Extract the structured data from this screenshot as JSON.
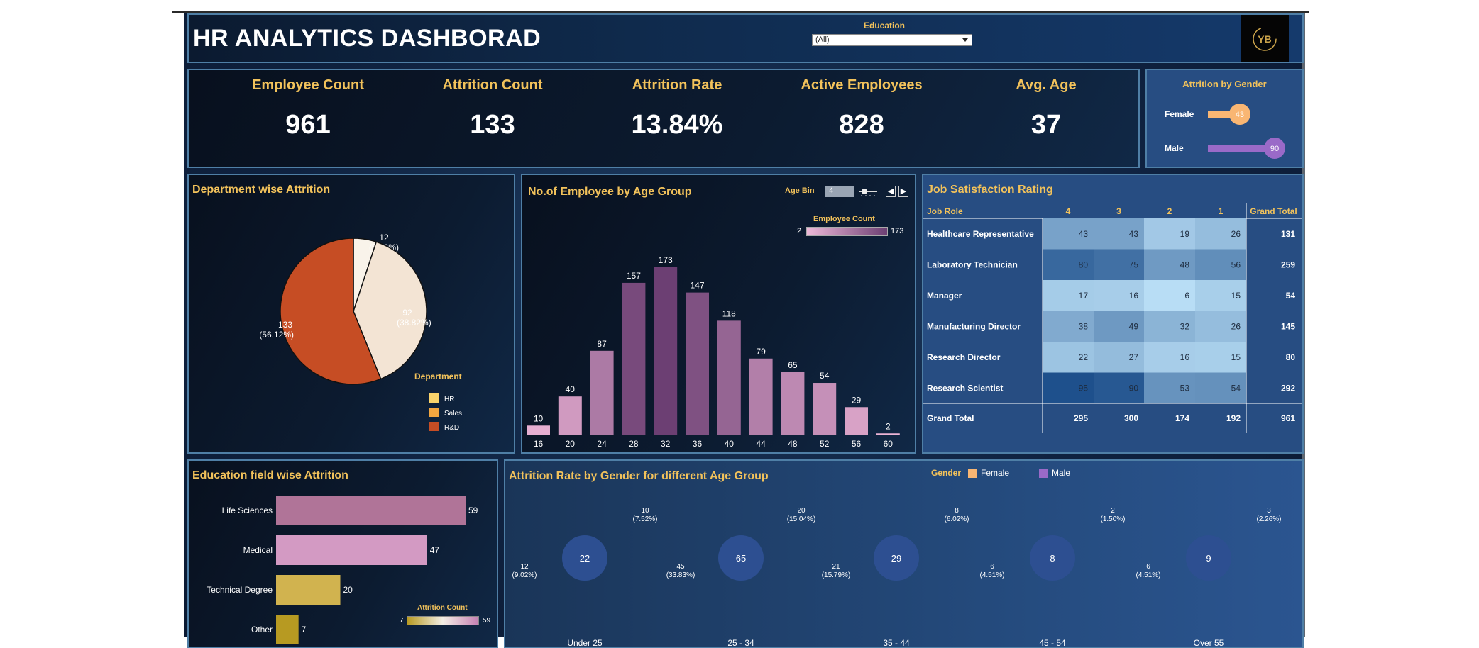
{
  "header": {
    "title": "HR ANALYTICS DASHBORAD",
    "filter_label": "Education",
    "filter_value": "(All)"
  },
  "kpis": [
    {
      "label": "Employee Count",
      "value": "961"
    },
    {
      "label": "Attrition Count",
      "value": "133"
    },
    {
      "label": "Attrition Rate",
      "value": "13.84%"
    },
    {
      "label": "Active Employees",
      "value": "828"
    },
    {
      "label": "Avg. Age",
      "value": "37"
    }
  ],
  "colors": {
    "female": "#f9b673",
    "male": "#9a6ac8",
    "accent": "#f2c25b",
    "rd": "#c64d24",
    "sales": "#f3e4d4",
    "hr": "#f9f3ea"
  },
  "chart_data": [
    {
      "id": "gender",
      "type": "bar",
      "title": "Attrition by Gender",
      "categories": [
        "Female",
        "Male"
      ],
      "values": [
        43,
        90
      ],
      "max": 90
    },
    {
      "id": "department",
      "type": "pie",
      "title": "Department wise Attrition",
      "legend_title": "Department",
      "legend": [
        "HR",
        "Sales",
        "R&D"
      ],
      "slices": [
        {
          "name": "HR",
          "value": 12,
          "label": "12",
          "pct": "(5.06%)"
        },
        {
          "name": "Sales",
          "value": 92,
          "label": "92",
          "pct": "(38.82%)"
        },
        {
          "name": "R&D",
          "value": 133,
          "label": "133",
          "pct": "(56.12%)"
        }
      ]
    },
    {
      "id": "age",
      "type": "bar",
      "title": "No.of Employee by Age Group",
      "bin_label": "Age Bin",
      "bin_value": "4",
      "legend_title": "Employee Count",
      "legend_min": "2",
      "legend_max": "173",
      "categories": [
        "16",
        "20",
        "24",
        "28",
        "32",
        "36",
        "40",
        "44",
        "48",
        "52",
        "56",
        "60"
      ],
      "values": [
        10,
        40,
        87,
        157,
        173,
        147,
        118,
        79,
        65,
        54,
        29,
        2
      ],
      "ylim": [
        0,
        173
      ]
    },
    {
      "id": "jobsat",
      "type": "heatmap",
      "title": "Job Satisfaction Rating",
      "row_header": "Job Role",
      "columns": [
        "4",
        "3",
        "2",
        "1"
      ],
      "total_label": "Grand Total",
      "rows": [
        {
          "role": "Healthcare Representative",
          "values": [
            43,
            43,
            19,
            26
          ],
          "total": "131"
        },
        {
          "role": "Laboratory Technician",
          "values": [
            80,
            75,
            48,
            56
          ],
          "total": "259"
        },
        {
          "role": "Manager",
          "values": [
            17,
            16,
            6,
            15
          ],
          "total": "54"
        },
        {
          "role": "Manufacturing Director",
          "values": [
            38,
            49,
            32,
            26
          ],
          "total": "145"
        },
        {
          "role": "Research Director",
          "values": [
            22,
            27,
            16,
            15
          ],
          "total": "80"
        },
        {
          "role": "Research Scientist",
          "values": [
            95,
            90,
            53,
            54
          ],
          "total": "292"
        }
      ],
      "grand_total_row": [
        "295",
        "300",
        "174",
        "192",
        "961"
      ]
    },
    {
      "id": "edufield",
      "type": "bar",
      "title": "Education field wise Attrition",
      "legend_title": "Attrition Count",
      "legend_min": "7",
      "legend_max": "59",
      "categories": [
        "Life Sciences",
        "Medical",
        "Technical Degree",
        "Other"
      ],
      "values": [
        59,
        47,
        20,
        7
      ],
      "colors": [
        "#b07498",
        "#d39ac3",
        "#d1b34f",
        "#b79a22"
      ],
      "max": 59
    },
    {
      "id": "genderage",
      "type": "pie",
      "title": "Attrition Rate by Gender for different Age Group",
      "legend_title": "Gender",
      "legend": [
        "Female",
        "Male"
      ],
      "groups": [
        {
          "name": "Under 25",
          "total": "22",
          "female": 10,
          "male": 12,
          "female_label": "10",
          "female_pct": "(7.52%)",
          "male_label": "12",
          "male_pct": "(9.02%)"
        },
        {
          "name": "25 - 34",
          "total": "65",
          "female": 20,
          "male": 45,
          "female_label": "20",
          "female_pct": "(15.04%)",
          "male_label": "45",
          "male_pct": "(33.83%)"
        },
        {
          "name": "35 - 44",
          "total": "29",
          "female": 8,
          "male": 21,
          "female_label": "8",
          "female_pct": "(6.02%)",
          "male_label": "21",
          "male_pct": "(15.79%)"
        },
        {
          "name": "45 - 54",
          "total": "8",
          "female": 2,
          "male": 6,
          "female_label": "2",
          "female_pct": "(1.50%)",
          "male_label": "6",
          "male_pct": "(4.51%)"
        },
        {
          "name": "Over 55",
          "total": "9",
          "female": 3,
          "male": 6,
          "female_label": "3",
          "female_pct": "(2.26%)",
          "male_label": "6",
          "male_pct": "(4.51%)"
        }
      ]
    }
  ]
}
